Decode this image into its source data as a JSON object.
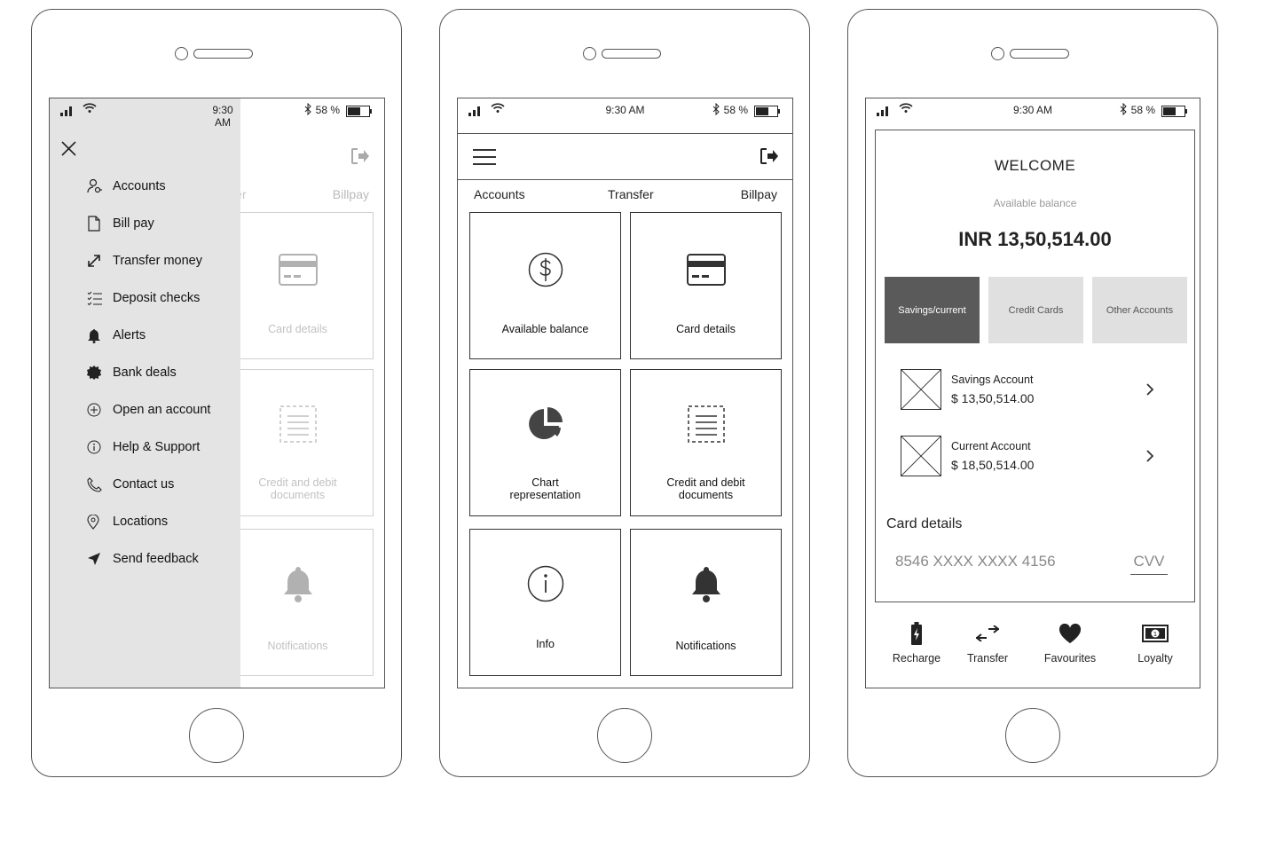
{
  "status_bar": {
    "time": "9:30 AM",
    "battery": "58 %"
  },
  "tabs": {
    "accounts": "Accounts",
    "transfer": "Transfer",
    "billpay": "Billpay"
  },
  "tiles": {
    "available_balance": "Available balance",
    "card_details": "Card details",
    "chart_line1": "Chart",
    "chart_line2": "representation",
    "credit_line1": "Credit and debit",
    "credit_line2": "documents",
    "info": "Info",
    "notifications": "Notifications"
  },
  "drawer_menu": {
    "items": [
      {
        "label": "Accounts",
        "icon": "user-key-icon"
      },
      {
        "label": "Bill pay",
        "icon": "document-icon"
      },
      {
        "label": "Transfer money",
        "icon": "expand-arrows-icon"
      },
      {
        "label": "Deposit checks",
        "icon": "checklist-icon"
      },
      {
        "label": "Alerts",
        "icon": "bell-icon"
      },
      {
        "label": "Bank deals",
        "icon": "badge-icon"
      },
      {
        "label": "Open an account",
        "icon": "plus-circle-icon"
      },
      {
        "label": "Help & Support",
        "icon": "info-circle-icon"
      },
      {
        "label": "Contact us",
        "icon": "phone-icon"
      },
      {
        "label": "Locations",
        "icon": "location-pin-icon"
      },
      {
        "label": "Send feedback",
        "icon": "send-icon"
      }
    ]
  },
  "dashboard": {
    "welcome": "WELCOME",
    "available_balance_label": "Available balance",
    "balance": "INR 13,50,514.00",
    "segments": [
      "Savings/current",
      "Credit Cards",
      "Other Accounts"
    ],
    "active_segment": "Savings/current",
    "accounts": [
      {
        "name": "Savings Account",
        "amount": "$ 13,50,514.00"
      },
      {
        "name": "Current Account",
        "amount": "$ 18,50,514.00"
      }
    ],
    "card_details_title": "Card details",
    "card_number": "8546 XXXX XXXX 4156",
    "cvv": "CVV"
  },
  "bottom_nav": [
    "Recharge",
    "Transfer",
    "Favourites",
    "Loyalty"
  ],
  "colors": {
    "active_segment": "#5a5a5a",
    "inactive_segment": "#e0e0e0",
    "drawer": "#e4e4e4",
    "icon": "#333333"
  }
}
